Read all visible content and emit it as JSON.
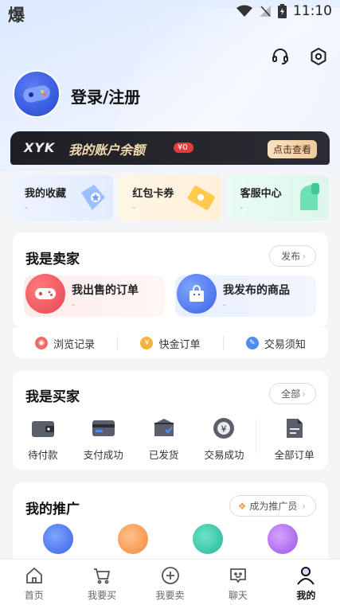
{
  "status_bar": {
    "app_glyph": "爆",
    "time": "11:10"
  },
  "header": {
    "login_text": "登录/注册"
  },
  "balance": {
    "logo": "XYK",
    "title": "我的账户余额",
    "amount": "¥0",
    "view_button": "点击查看"
  },
  "quick_cards": [
    {
      "title": "我的收藏",
      "sub": "-",
      "icon": "star-tag-icon"
    },
    {
      "title": "红包卡券",
      "sub": "-",
      "icon": "coupon-icon"
    },
    {
      "title": "客服中心",
      "sub": "-",
      "icon": "support-hand-icon"
    }
  ],
  "seller": {
    "title": "我是卖家",
    "publish_button": "发布",
    "tiles": [
      {
        "title": "我出售的订单",
        "sub": "-"
      },
      {
        "title": "我发布的商品",
        "sub": "-"
      }
    ],
    "links": [
      "浏览记录",
      "快金订单",
      "交易须知"
    ]
  },
  "buyer": {
    "title": "我是买家",
    "all_button": "全部",
    "orders": [
      "待付款",
      "支付成功",
      "已发货",
      "交易成功",
      "全部订单"
    ]
  },
  "promo": {
    "title": "我的推广",
    "become_button": "成为推广员"
  },
  "tabbar": {
    "items": [
      "首页",
      "我要买",
      "我要卖",
      "聊天",
      "我的"
    ],
    "active_index": 4
  },
  "colors": {
    "accent_blue": "#3a63e6",
    "seller_red": "#e9474f",
    "balance_gold": "#f3d9b1"
  }
}
